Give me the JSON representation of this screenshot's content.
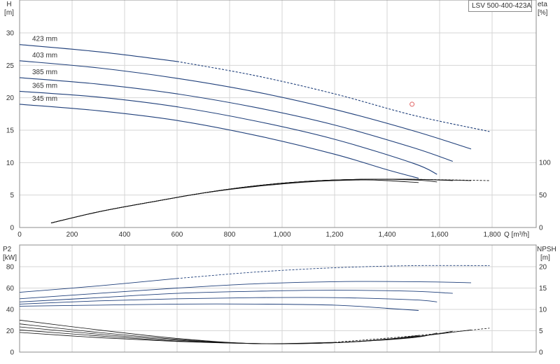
{
  "title": "LSV 500-400-423A",
  "colors": {
    "head_curve": "#1f3f7a",
    "efficiency_curve": "#111111",
    "duty_point": "#e06060",
    "grid": "#d6d6d6"
  },
  "axes": {
    "h_label": "H",
    "h_unit": "[m]",
    "eta_label": "eta",
    "eta_unit": "[%]",
    "q_label": "Q [m³/h]",
    "p2_label": "P2",
    "p2_unit": "[kW]",
    "npsh_label": "NPSH",
    "npsh_unit": "[m]",
    "x_ticks": [
      "0",
      "200",
      "400",
      "600",
      "800",
      "1,000",
      "1,200",
      "1,400",
      "1,600",
      "1,800"
    ],
    "h_ticks": [
      "0",
      "5",
      "10",
      "15",
      "20",
      "25",
      "30"
    ],
    "eta_ticks": [
      "0",
      "50",
      "100"
    ],
    "p2_ticks": [
      "0",
      "20",
      "40",
      "60",
      "80"
    ],
    "npsh_ticks": [
      "0",
      "5",
      "10",
      "15",
      "20"
    ]
  },
  "chart_data": [
    {
      "type": "line",
      "title": "LSV 500-400-423A",
      "xlabel": "Q [m³/h]",
      "ylabel": "H [m]",
      "y2label": "eta [%]",
      "xlim": [
        0,
        1800
      ],
      "ylim": [
        0,
        30
      ],
      "y2lim": [
        0,
        150
      ],
      "grid": true,
      "head_series": [
        {
          "name": "423 mm",
          "x": [
            0,
            300,
            600,
            900,
            1200,
            1500,
            1790
          ],
          "y": [
            28.2,
            27.1,
            25.6,
            23.4,
            20.6,
            17.3,
            14.8
          ],
          "dashed_from": 750
        },
        {
          "name": "403 mm",
          "x": [
            0,
            300,
            600,
            900,
            1200,
            1500,
            1720
          ],
          "y": [
            25.7,
            24.6,
            23.0,
            20.9,
            18.2,
            14.9,
            12.1
          ]
        },
        {
          "name": "385 mm",
          "x": [
            0,
            300,
            600,
            900,
            1200,
            1500,
            1650
          ],
          "y": [
            23.1,
            22.1,
            20.6,
            18.5,
            15.8,
            12.3,
            10.2
          ]
        },
        {
          "name": "365 mm",
          "x": [
            0,
            300,
            600,
            900,
            1200,
            1500,
            1590
          ],
          "y": [
            21.0,
            20.1,
            18.6,
            16.4,
            13.6,
            9.9,
            8.2
          ]
        },
        {
          "name": "345 mm",
          "x": [
            0,
            300,
            600,
            900,
            1200,
            1400,
            1520
          ],
          "y": [
            19.0,
            18.0,
            16.5,
            14.2,
            11.3,
            8.9,
            7.6
          ]
        }
      ],
      "efficiency_series": [
        {
          "x": [
            120,
            300,
            500,
            700,
            900,
            1100,
            1300,
            1400,
            1520
          ],
          "y": [
            7,
            24,
            39,
            53,
            63,
            70,
            73,
            72,
            69
          ]
        },
        {
          "x": [
            120,
            300,
            500,
            700,
            900,
            1100,
            1300,
            1500,
            1590
          ],
          "y": [
            7,
            24,
            39,
            53,
            64,
            71,
            74,
            73,
            70
          ]
        },
        {
          "x": [
            120,
            300,
            500,
            700,
            900,
            1100,
            1300,
            1500,
            1650
          ],
          "y": [
            7,
            24,
            39,
            53,
            64,
            71,
            74,
            74,
            72
          ]
        },
        {
          "x": [
            120,
            300,
            500,
            700,
            900,
            1100,
            1300,
            1500,
            1720
          ],
          "y": [
            7,
            24,
            39,
            53,
            64,
            71,
            74,
            74,
            72
          ]
        },
        {
          "x": [
            120,
            300,
            500,
            700,
            900,
            1100,
            1300,
            1500,
            1790
          ],
          "y": [
            7,
            24,
            39,
            53,
            64,
            71,
            74,
            74,
            72
          ],
          "dashed_from": 1300
        }
      ],
      "duty_point": {
        "x": 1495,
        "y": 19.0
      }
    },
    {
      "type": "line",
      "xlabel": "Q [m³/h]",
      "ylabel": "P2 [kW]",
      "y2label": "NPSH [m]",
      "xlim": [
        0,
        1800
      ],
      "ylim": [
        0,
        100
      ],
      "y2lim": [
        0,
        25
      ],
      "grid": true,
      "power_series": [
        {
          "name": "423 mm",
          "x": [
            0,
            300,
            600,
            900,
            1200,
            1500,
            1790
          ],
          "y": [
            56,
            62,
            69,
            75,
            79,
            81,
            81
          ],
          "dashed_from": 750
        },
        {
          "name": "403 mm",
          "x": [
            0,
            300,
            600,
            900,
            1200,
            1500,
            1720
          ],
          "y": [
            50,
            55,
            60,
            64,
            66,
            66,
            65
          ]
        },
        {
          "name": "385 mm",
          "x": [
            0,
            300,
            600,
            900,
            1200,
            1500,
            1650
          ],
          "y": [
            47,
            51,
            55,
            57,
            58,
            57,
            55
          ]
        },
        {
          "name": "365 mm",
          "x": [
            0,
            300,
            600,
            900,
            1200,
            1500,
            1590
          ],
          "y": [
            45,
            48,
            50,
            51,
            51,
            49,
            47
          ]
        },
        {
          "name": "345 mm",
          "x": [
            0,
            300,
            600,
            900,
            1200,
            1400,
            1520
          ],
          "y": [
            43,
            44,
            45,
            45,
            44,
            41,
            39
          ]
        }
      ],
      "npsh_series": [
        {
          "x": [
            0,
            300,
            600,
            900,
            1200,
            1500,
            1790
          ],
          "y": [
            7.5,
            5.2,
            3.2,
            2.0,
            2.3,
            3.8,
            5.6
          ],
          "dashed_from": 1300
        },
        {
          "x": [
            0,
            300,
            600,
            900,
            1200,
            1500,
            1720
          ],
          "y": [
            6.6,
            4.6,
            3.0,
            2.0,
            2.2,
            3.6,
            5.2
          ]
        },
        {
          "x": [
            0,
            300,
            600,
            900,
            1200,
            1500,
            1650
          ],
          "y": [
            5.9,
            4.2,
            2.8,
            2.0,
            2.2,
            3.5,
            4.9
          ]
        },
        {
          "x": [
            0,
            300,
            600,
            900,
            1200,
            1500,
            1590
          ],
          "y": [
            5.2,
            3.8,
            2.6,
            2.0,
            2.2,
            3.4,
            4.5
          ]
        },
        {
          "x": [
            0,
            300,
            600,
            900,
            1200,
            1400,
            1520
          ],
          "y": [
            4.6,
            3.4,
            2.5,
            2.0,
            2.2,
            3.0,
            3.9
          ]
        }
      ]
    }
  ]
}
